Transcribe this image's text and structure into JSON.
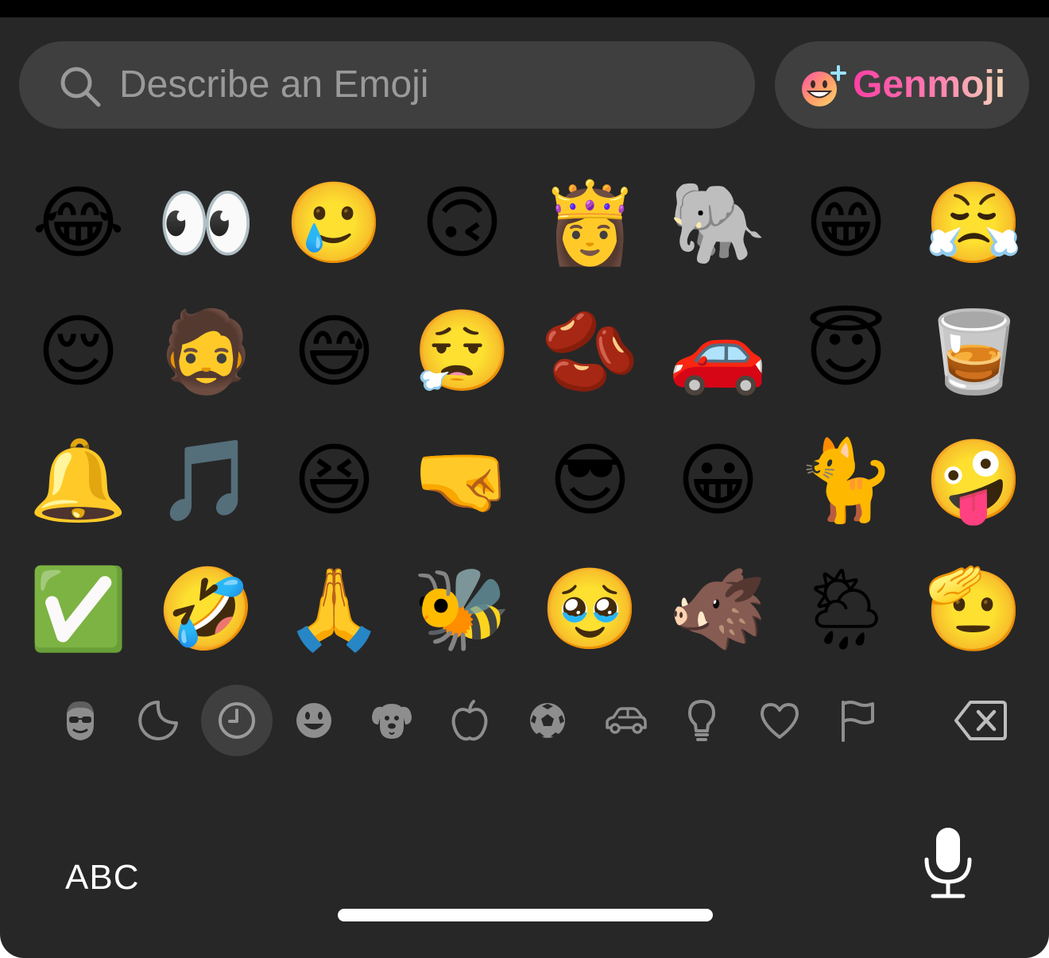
{
  "search": {
    "placeholder": "Describe an Emoji",
    "icon": "magnifying-glass-icon"
  },
  "genmoji": {
    "label": "Genmoji",
    "icon": "genmoji-smiley-plus-icon",
    "gradient": [
      "#ff3fa4",
      "#ff7fb0",
      "#f3d6b8"
    ]
  },
  "emojis": [
    {
      "name": "face-with-tears-of-joy",
      "glyph": "😂"
    },
    {
      "name": "eyes",
      "glyph": "👀"
    },
    {
      "name": "memoji-crying",
      "glyph": "🥲"
    },
    {
      "name": "upside-down-face",
      "glyph": "🙃"
    },
    {
      "name": "princess",
      "glyph": "👸"
    },
    {
      "name": "genmoji-elephant",
      "glyph": "🐘"
    },
    {
      "name": "grinning-face-with-smiling-eyes",
      "glyph": "😁"
    },
    {
      "name": "face-with-steam-from-nose",
      "glyph": "😤"
    },
    {
      "name": "relieved-face",
      "glyph": "😌"
    },
    {
      "name": "memoji-sad",
      "glyph": "🧔"
    },
    {
      "name": "grinning-face-with-sweat",
      "glyph": "😅"
    },
    {
      "name": "face-exhaling",
      "glyph": "😮‍💨"
    },
    {
      "name": "genmoji-bean-splash",
      "glyph": "🫘"
    },
    {
      "name": "automobile",
      "glyph": "🚗"
    },
    {
      "name": "smiling-face-with-halo",
      "glyph": "😇"
    },
    {
      "name": "genmoji-whisky-wheels",
      "glyph": "🥃"
    },
    {
      "name": "genmoji-crying-bell",
      "glyph": "🔔"
    },
    {
      "name": "musical-notes",
      "glyph": "🎵"
    },
    {
      "name": "grinning-squinting-face",
      "glyph": "😆"
    },
    {
      "name": "memoji-fist-bump",
      "glyph": "🤜"
    },
    {
      "name": "smiling-face-with-sunglasses",
      "glyph": "😎"
    },
    {
      "name": "grinning-face",
      "glyph": "😀"
    },
    {
      "name": "genmoji-cat-on-platform",
      "glyph": "🐈"
    },
    {
      "name": "zany-face",
      "glyph": "🤪"
    },
    {
      "name": "check-mark-button",
      "glyph": "✅"
    },
    {
      "name": "rolling-on-the-floor-laughing",
      "glyph": "🤣"
    },
    {
      "name": "memoji-praying",
      "glyph": "🙏"
    },
    {
      "name": "honeybee",
      "glyph": "🐝"
    },
    {
      "name": "face-holding-back-tears",
      "glyph": "🥹"
    },
    {
      "name": "genmoji-crying-tapir",
      "glyph": "🐗"
    },
    {
      "name": "sun-behind-rain-cloud",
      "glyph": "🌦"
    },
    {
      "name": "saluting-face",
      "glyph": "🫡"
    }
  ],
  "categories": [
    {
      "name": "memoji-category",
      "selected": false
    },
    {
      "name": "stickers-category",
      "selected": false
    },
    {
      "name": "recents-category",
      "selected": true
    },
    {
      "name": "smileys-category",
      "selected": false
    },
    {
      "name": "animals-category",
      "selected": false
    },
    {
      "name": "food-category",
      "selected": false
    },
    {
      "name": "activity-category",
      "selected": false
    },
    {
      "name": "travel-category",
      "selected": false
    },
    {
      "name": "objects-category",
      "selected": false
    },
    {
      "name": "symbols-category",
      "selected": false
    },
    {
      "name": "flags-category",
      "selected": false
    }
  ],
  "keys": {
    "abc": "ABC",
    "delete_icon": "delete-backspace-icon",
    "mic_icon": "microphone-icon"
  },
  "colors": {
    "keyboard_bg": "#272727",
    "field_bg": "#3f3f3f",
    "placeholder": "#9a9a9a",
    "icon_gray": "#8e8e8e"
  }
}
